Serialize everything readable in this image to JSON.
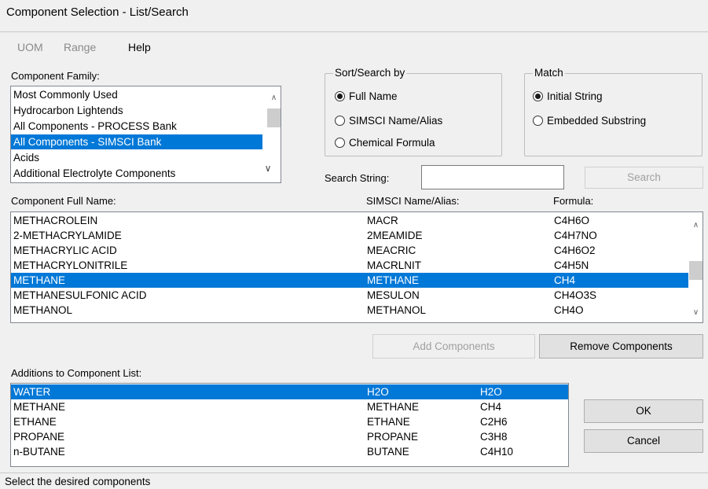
{
  "window": {
    "title": "Component Selection - List/Search"
  },
  "menu": {
    "uom": "UOM",
    "range": "Range",
    "help": "Help"
  },
  "family": {
    "label": "Component Family:",
    "items": [
      "Most Commonly Used",
      "Hydrocarbon Lightends",
      "All Components - PROCESS Bank",
      "All Components - SIMSCI Bank",
      "Acids",
      "Additional Electrolyte Components"
    ],
    "selected_index": 3
  },
  "sort": {
    "title": "Sort/Search by",
    "options": [
      "Full Name",
      "SIMSCI Name/Alias",
      "Chemical Formula"
    ],
    "selected": "Full Name"
  },
  "match": {
    "title": "Match",
    "options": [
      "Initial String",
      "Embedded Substring"
    ],
    "selected": "Initial String"
  },
  "search": {
    "label": "Search String:",
    "value": "",
    "button": "Search"
  },
  "components": {
    "headers": {
      "name": "Component Full Name:",
      "alias": "SIMSCI Name/Alias:",
      "formula": "Formula:"
    },
    "rows": [
      {
        "name": "METHACROLEIN",
        "alias": "MACR",
        "formula": "C4H6O"
      },
      {
        "name": "2-METHACRYLAMIDE",
        "alias": "2MEAMIDE",
        "formula": "C4H7NO"
      },
      {
        "name": "METHACRYLIC ACID",
        "alias": "MEACRIC",
        "formula": "C4H6O2"
      },
      {
        "name": "METHACRYLONITRILE",
        "alias": "MACRLNIT",
        "formula": "C4H5N"
      },
      {
        "name": "METHANE",
        "alias": "METHANE",
        "formula": "CH4"
      },
      {
        "name": "METHANESULFONIC ACID",
        "alias": "MESULON",
        "formula": "CH4O3S"
      },
      {
        "name": "METHANOL",
        "alias": "METHANOL",
        "formula": "CH4O"
      }
    ],
    "selected_index": 4
  },
  "buttons": {
    "add": "Add Components",
    "remove": "Remove Components",
    "ok": "OK",
    "cancel": "Cancel"
  },
  "additions": {
    "label": "Additions to Component List:",
    "rows": [
      {
        "name": "WATER",
        "alias": "H2O",
        "formula": "H2O"
      },
      {
        "name": "METHANE",
        "alias": "METHANE",
        "formula": "CH4"
      },
      {
        "name": "ETHANE",
        "alias": "ETHANE",
        "formula": "C2H6"
      },
      {
        "name": "PROPANE",
        "alias": "PROPANE",
        "formula": "C3H8"
      },
      {
        "name": "n-BUTANE",
        "alias": "BUTANE",
        "formula": "C4H10"
      }
    ],
    "selected_index": 0
  },
  "status": {
    "text": "Select the desired components"
  },
  "colors": {
    "selection": "#0078d7",
    "background": "#f0f0f0"
  }
}
